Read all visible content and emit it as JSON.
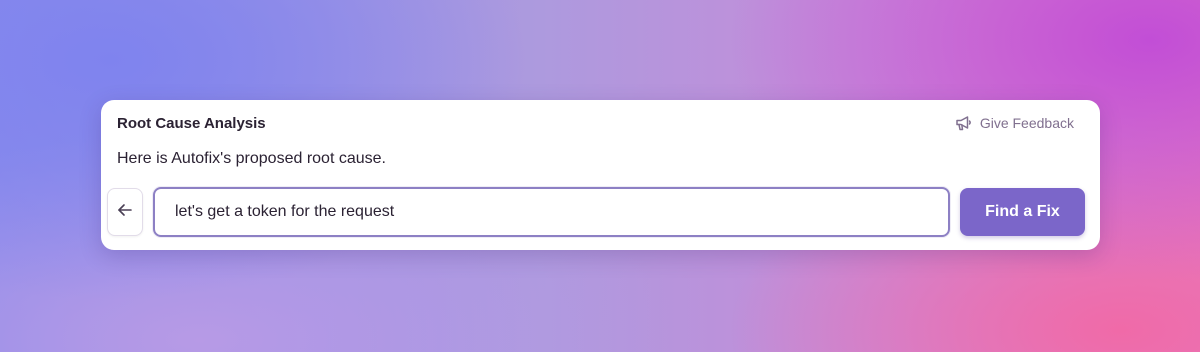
{
  "card": {
    "title": "Root Cause Analysis",
    "subtitle": "Here is Autofix's proposed root cause.",
    "feedback": {
      "label": "Give Feedback",
      "icon": "megaphone-icon"
    }
  },
  "input": {
    "value": "let's get a token for the request",
    "back_icon": "arrow-left-icon"
  },
  "action": {
    "label": "Find a Fix"
  },
  "colors": {
    "accent": "#7b66c9",
    "input_border": "#8d80c4",
    "text": "#2b2233",
    "muted": "#80708f"
  }
}
